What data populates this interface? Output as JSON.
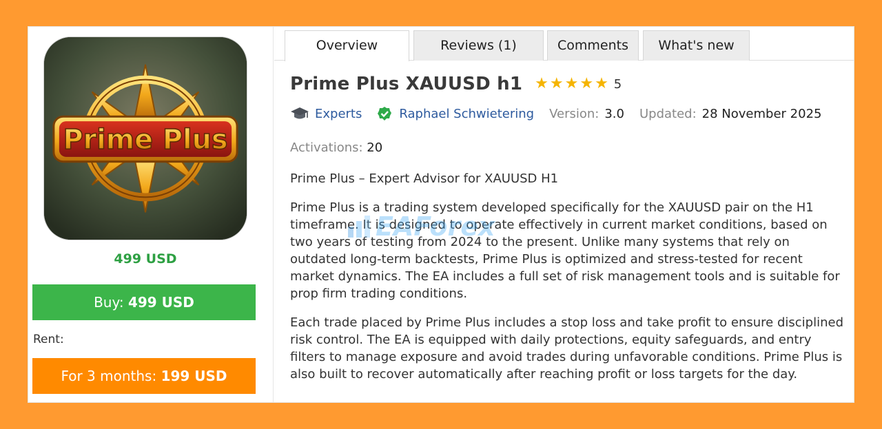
{
  "product": {
    "logo_text": "Prime Plus",
    "price": "499 USD",
    "buy_label": "Buy:",
    "buy_price": "499 USD",
    "rent_label": "Rent:",
    "rent_option_label": "For 3 months:",
    "rent_option_price": "199 USD"
  },
  "tabs": [
    {
      "label": "Overview",
      "active": true
    },
    {
      "label": "Reviews (1)",
      "active": false
    },
    {
      "label": "Comments",
      "active": false
    },
    {
      "label": "What's new",
      "active": false
    }
  ],
  "header": {
    "title": "Prime Plus XAUUSD h1",
    "rating": "5",
    "rating_value": 5
  },
  "meta": {
    "category": "Experts",
    "author": "Raphael Schwietering",
    "version_label": "Version:",
    "version": "3.0",
    "updated_label": "Updated:",
    "updated": "28 November 2025",
    "activations_label": "Activations:",
    "activations": "20"
  },
  "description": {
    "heading": "Prime Plus – Expert Advisor for XAUUSD H1",
    "paragraph1": "Prime Plus is a trading system developed specifically for the XAUUSD pair on the H1 timeframe. It is designed to operate effectively in current market conditions, based on two years of testing from 2024 to the present. Unlike many systems that rely on outdated long-term backtests, Prime Plus is optimized and stress-tested for recent market dynamics. The EA includes a full set of risk management tools and is suitable for prop firm trading conditions.",
    "paragraph2": "Each trade placed by Prime Plus includes a stop loss and take profit to ensure disciplined risk control. The EA is equipped with daily protections, equity safeguards, and entry filters to manage exposure and avoid trades during unfavorable conditions. Prime Plus is also built to recover automatically after reaching profit or loss targets for the day."
  },
  "watermark": {
    "text": "EAForex"
  },
  "colors": {
    "page_bg": "#ff9a30",
    "price_green": "#2ea043",
    "buy_green": "#3cb54a",
    "rent_orange": "#ff8a00",
    "link_blue": "#2d5a9e",
    "star_gold": "#f5b400"
  },
  "icons": {
    "category": "graduation-cap-icon",
    "author": "verified-check-icon",
    "star": "star-icon"
  }
}
